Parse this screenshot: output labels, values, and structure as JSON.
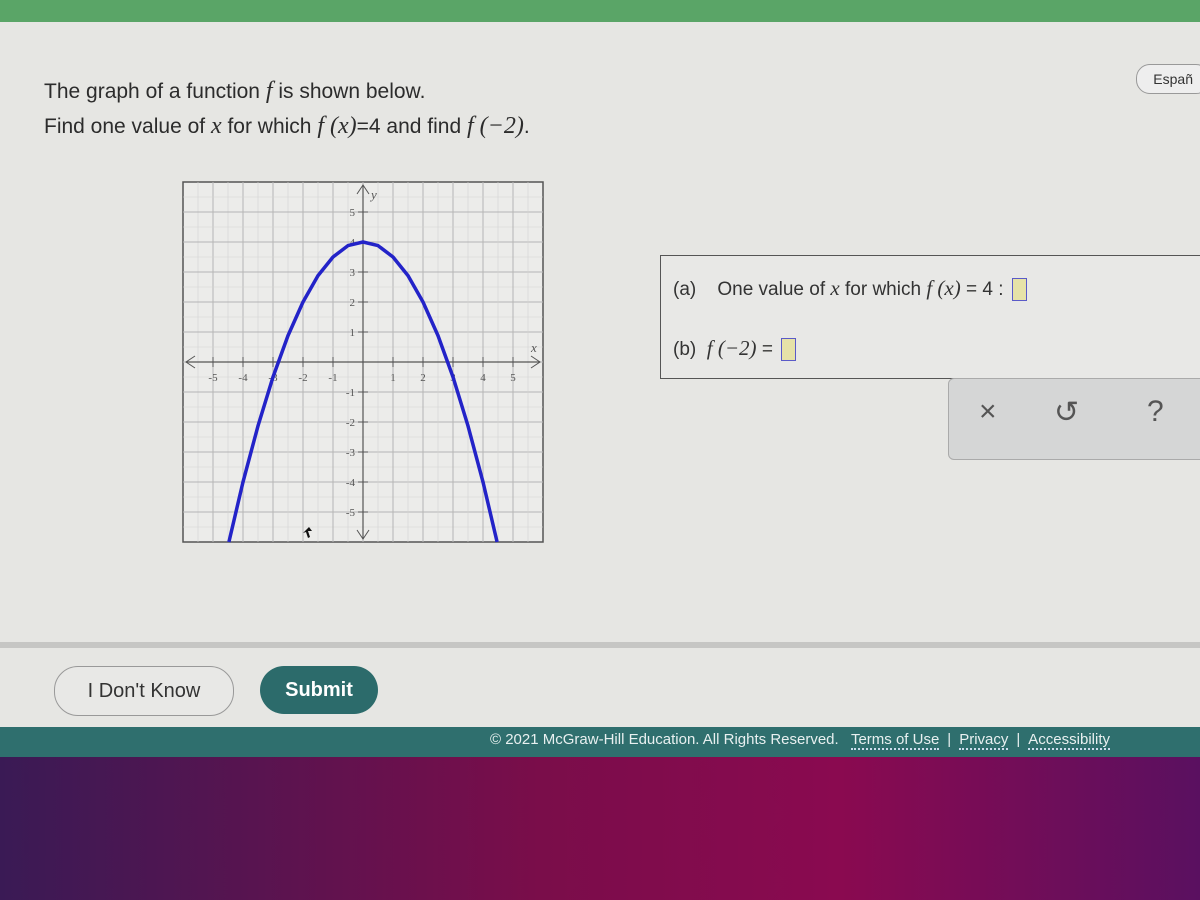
{
  "header": {
    "language_button": "Españ"
  },
  "question": {
    "line1_pre": "The graph of a function ",
    "line1_f": "f",
    "line1_post": " is shown below.",
    "line2_a": "Find one value of ",
    "line2_x": "x",
    "line2_b": " for which ",
    "line2_fx": "f (x)",
    "line2_c": "=4 and find ",
    "line2_f2": "f (−2)",
    "line2_d": "."
  },
  "chart_data": {
    "type": "line",
    "xlabel": "x",
    "ylabel": "y",
    "xlim": [
      -6,
      6
    ],
    "ylim": [
      -6,
      6
    ],
    "grid": true,
    "x_ticks": [
      "-5",
      "-4",
      "-3",
      "-2",
      "-1",
      "1",
      "2",
      "3",
      "4",
      "5"
    ],
    "y_ticks": [
      "5",
      "4",
      "3",
      "2",
      "1",
      "-1",
      "-2",
      "-3",
      "-4",
      "-5"
    ],
    "curve_color": "#2323c8",
    "series": [
      {
        "x": [
          -4.47,
          -4,
          -3.5,
          -3,
          -2.5,
          -2,
          -1.5,
          -1,
          -0.5,
          0,
          0.5,
          1,
          1.5,
          2,
          2.5,
          3,
          3.5,
          4,
          4.47
        ],
        "y": [
          -6,
          -4,
          -2.13,
          -0.5,
          0.88,
          2,
          2.88,
          3.5,
          3.88,
          4,
          3.88,
          3.5,
          2.88,
          2,
          0.88,
          -0.5,
          -2.13,
          -4,
          -6
        ]
      }
    ]
  },
  "answers": {
    "a_label": "(a)",
    "a_text": "One value of ",
    "a_x": "x",
    "a_mid": " for which ",
    "a_fx": "f (x)",
    "a_end": " = 4 :",
    "b_label": "(b)",
    "b_fx": "f (−2)",
    "b_end": " ="
  },
  "tools": {
    "clear": "×",
    "undo": "↺",
    "help": "?"
  },
  "buttons": {
    "idk": "I Don't Know",
    "submit": "Submit"
  },
  "footer": {
    "copyright": "© 2021 McGraw-Hill Education. All Rights Reserved.",
    "terms": "Terms of Use",
    "privacy": "Privacy",
    "accessibility": "Accessibility",
    "sep": "|"
  }
}
